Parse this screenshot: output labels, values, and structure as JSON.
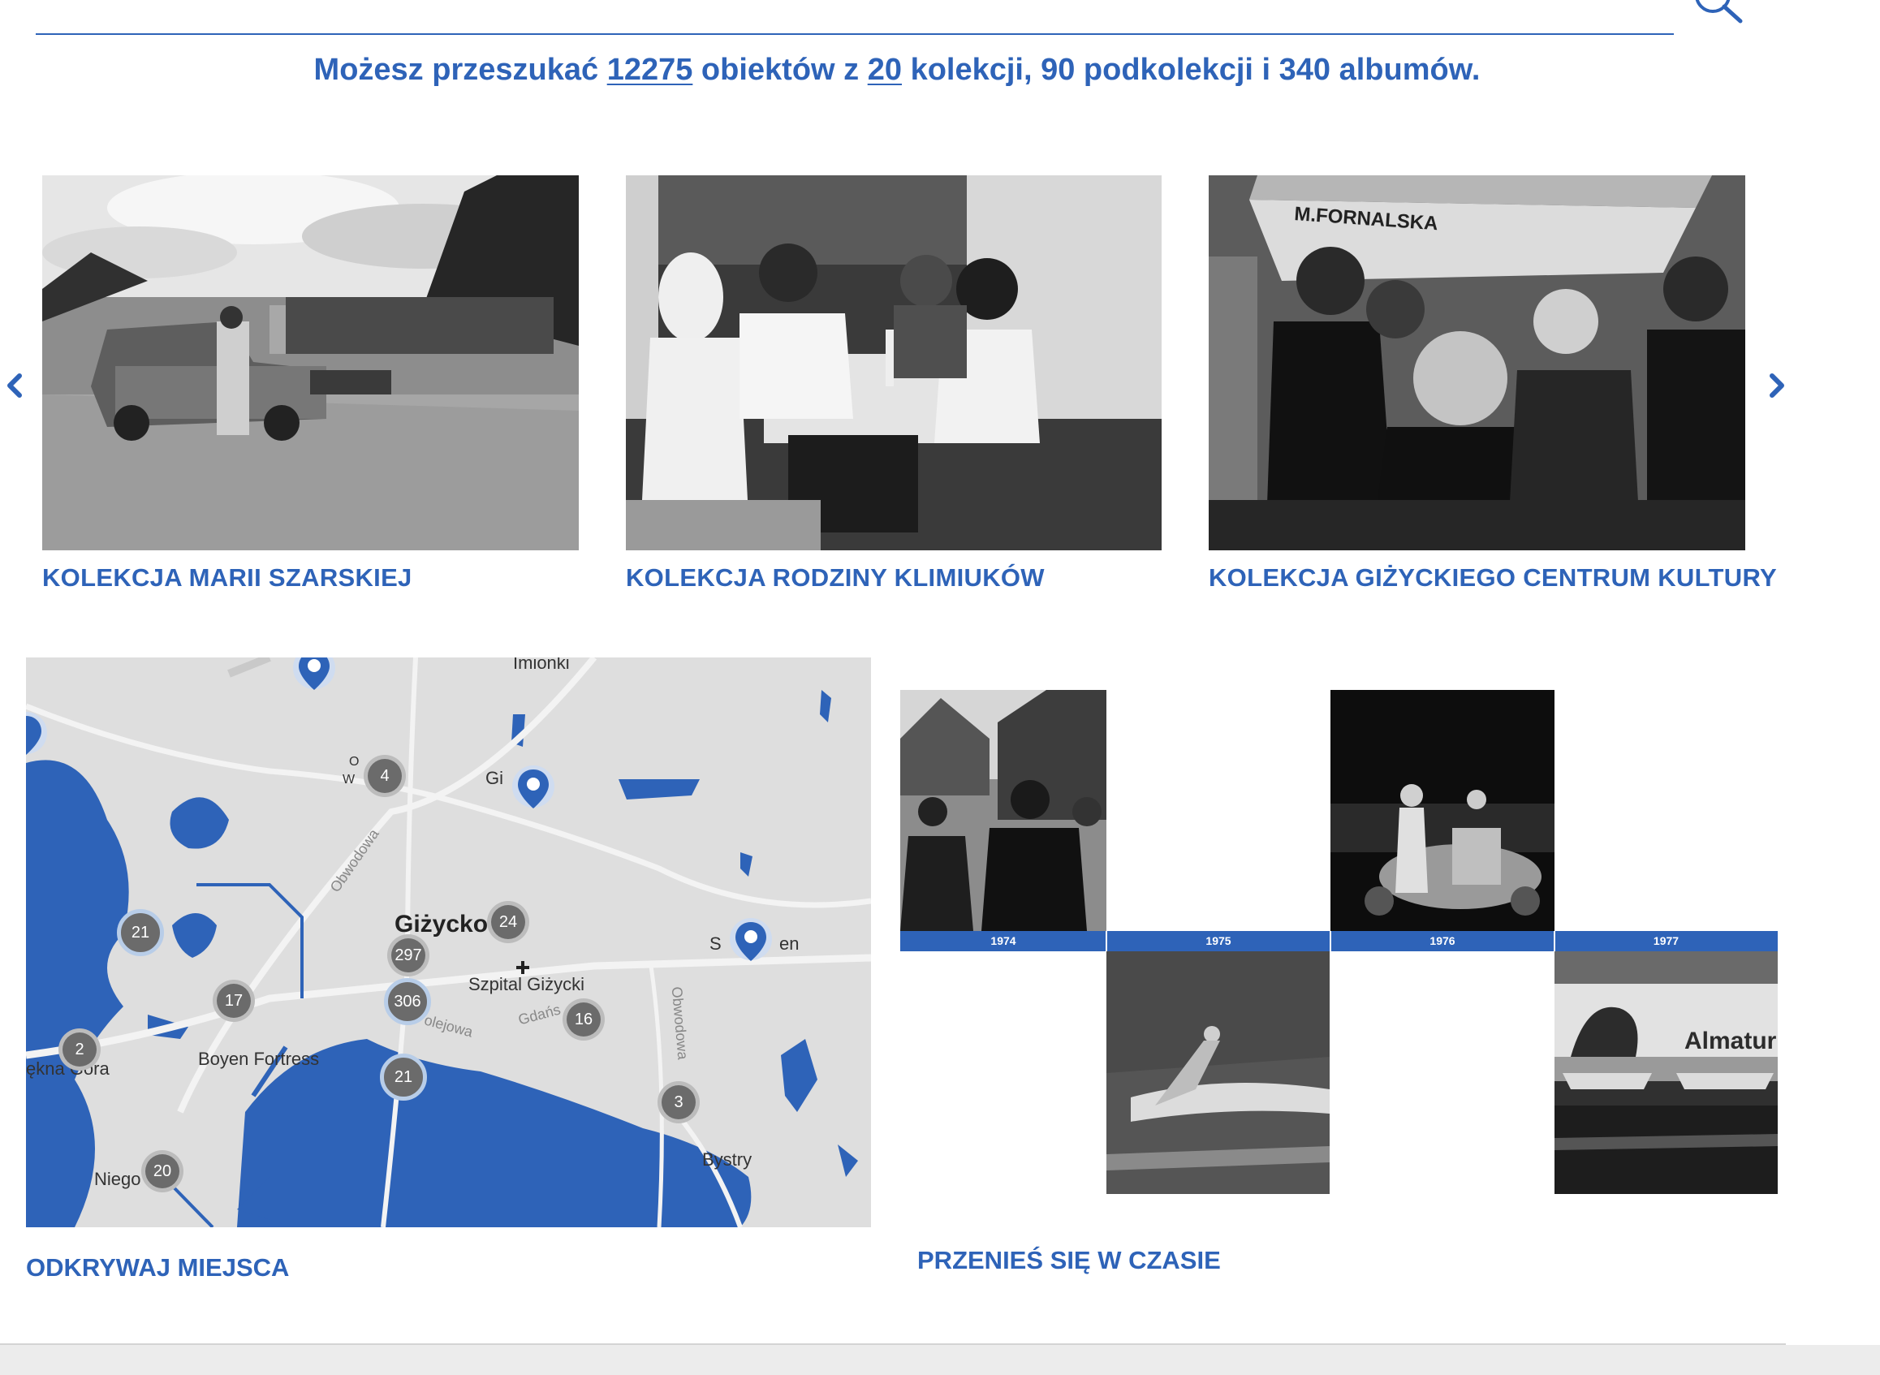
{
  "stats": {
    "prefix": "Możesz przeszukać",
    "objects": "12275",
    "mid1": "obiektów z",
    "collections": "20",
    "suffix": "kolekcji, 90 podkolekcji i 340 albumów."
  },
  "carousel": {
    "items": [
      {
        "title": "KOLEKCJA MARII SZARSKIEJ"
      },
      {
        "title": "KOLEKCJA RODZINY KLIMIUKÓW"
      },
      {
        "title": "KOLEKCJA GIŻYCKIEGO CENTRUM KULTURY"
      }
    ],
    "boat_text": "M.FORNALSKA"
  },
  "map": {
    "title": "ODKRYWAJ MIEJSCA",
    "clusters": [
      "4",
      "24",
      "297",
      "306",
      "21",
      "17",
      "16",
      "21",
      "2",
      "3",
      "20"
    ],
    "labels": {
      "imionki": "Imionki",
      "gizycko": "Giżycko",
      "szpital": "Szpital Giżycki",
      "boyen": "Boyen Fortress",
      "bystry": "Bystry",
      "niego": "Niego",
      "gie": "Gi",
      "sen": "S",
      "sen2": "en",
      "ekna": "ękna Góra",
      "ow": "O",
      "w": "W",
      "obwodowa1": "Obwodowa",
      "obwodowa2": "Obwodowa",
      "gdansk": "Gdańs",
      "olejowa": "olejowa"
    }
  },
  "timeline": {
    "title": "PRZENIEŚ SIĘ W CZASIE",
    "years": [
      "1974",
      "1975",
      "1976",
      "1977"
    ],
    "sign_text": "Almatur"
  }
}
